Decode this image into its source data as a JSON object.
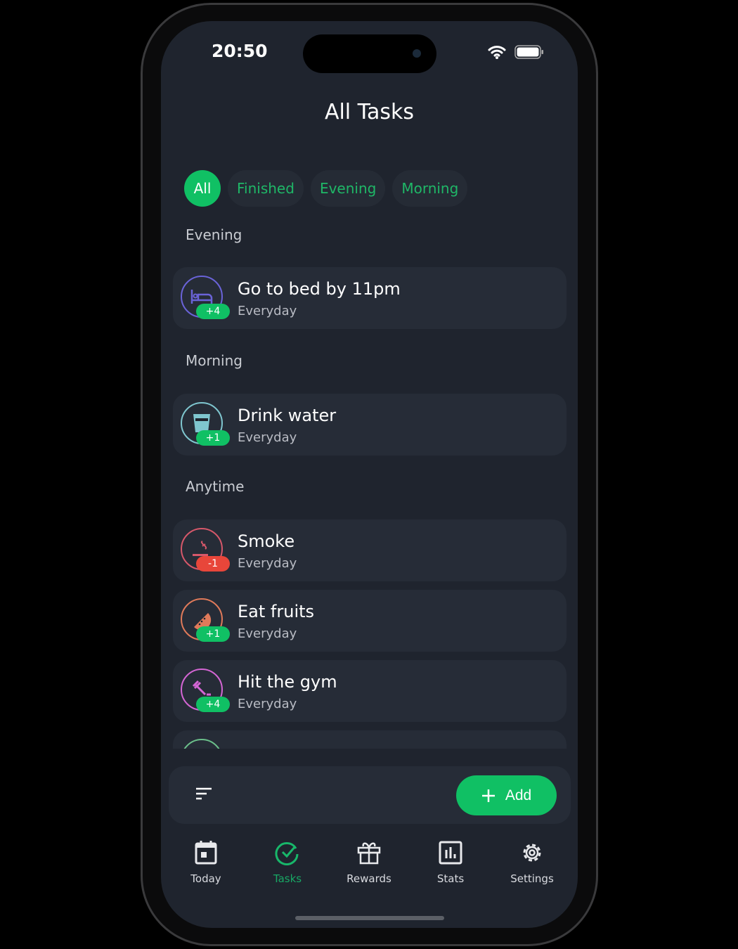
{
  "status": {
    "time": "20:50"
  },
  "header": {
    "title": "All Tasks"
  },
  "filters": [
    {
      "label": "All",
      "active": true
    },
    {
      "label": "Finished"
    },
    {
      "label": "Evening"
    },
    {
      "label": "Morning"
    }
  ],
  "sections": [
    {
      "label": "Evening",
      "tasks": [
        {
          "name": "Go to bed by 11pm",
          "schedule": "Everyday",
          "points": "+4",
          "icon": "bed-icon",
          "color": "#6a63d8"
        }
      ]
    },
    {
      "label": "Morning",
      "tasks": [
        {
          "name": "Drink water",
          "schedule": "Everyday",
          "points": "+1",
          "icon": "glass-icon",
          "color": "#7fc6cf"
        }
      ]
    },
    {
      "label": "Anytime",
      "tasks": [
        {
          "name": "Smoke",
          "schedule": "Everyday",
          "points": "-1",
          "icon": "smoke-icon",
          "color": "#d6586a"
        },
        {
          "name": "Eat fruits",
          "schedule": "Everyday",
          "points": "+1",
          "icon": "watermelon-icon",
          "color": "#e07a5a"
        },
        {
          "name": "Hit the gym",
          "schedule": "Everyday",
          "points": "+4",
          "icon": "dumbbell-icon",
          "color": "#d466d4"
        }
      ]
    }
  ],
  "bottom_bar": {
    "sort_icon": "sort-icon",
    "add_label": "Add"
  },
  "nav": [
    {
      "label": "Today",
      "icon": "calendar-icon"
    },
    {
      "label": "Tasks",
      "icon": "check-circle-icon",
      "active": true
    },
    {
      "label": "Rewards",
      "icon": "gift-icon"
    },
    {
      "label": "Stats",
      "icon": "chart-icon"
    },
    {
      "label": "Settings",
      "icon": "gear-icon"
    }
  ],
  "colors": {
    "accent": "#10c064",
    "negative": "#e8463a",
    "background": "#1f242e",
    "card": "#262c37"
  }
}
